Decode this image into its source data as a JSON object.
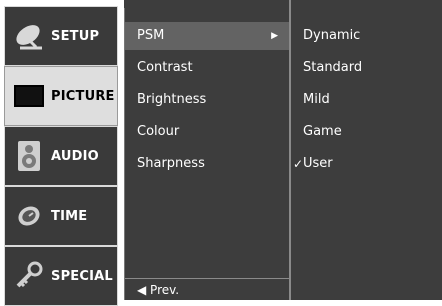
{
  "nav": {
    "items": [
      {
        "label": "SETUP",
        "icon": "satellite-dish-icon"
      },
      {
        "label": "PICTURE",
        "icon": "tv-screen-icon"
      },
      {
        "label": "AUDIO",
        "icon": "speaker-icon"
      },
      {
        "label": "TIME",
        "icon": "clock-icon"
      },
      {
        "label": "SPECIAL",
        "icon": "key-icon"
      }
    ],
    "active": "PICTURE"
  },
  "submenu": {
    "items": [
      {
        "label": "PSM",
        "arrow": "▶"
      },
      {
        "label": "Contrast"
      },
      {
        "label": "Brightness"
      },
      {
        "label": "Colour"
      },
      {
        "label": "Sharpness"
      }
    ],
    "prev": "◀ Prev."
  },
  "options": {
    "items": [
      {
        "label": "Dynamic"
      },
      {
        "label": "Standard"
      },
      {
        "label": "Mild"
      },
      {
        "label": "Game"
      },
      {
        "label": "User",
        "check": "✓"
      }
    ]
  }
}
